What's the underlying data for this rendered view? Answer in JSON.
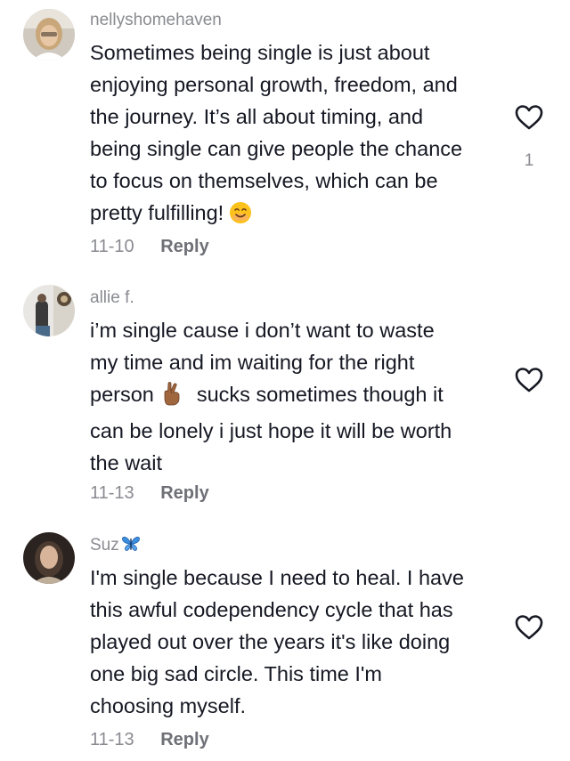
{
  "comments": [
    {
      "username": "nellyshomehaven",
      "lines": [
        "Sometimes being single is just about",
        "enjoying personal growth, freedom, and",
        "the journey. It’s all about timing, and",
        "being single can give people the chance",
        "to focus on themselves, which can be",
        "pretty fulfilling!"
      ],
      "emoji": "smiling-face-emoji",
      "date": "11-10",
      "reply_label": "Reply",
      "like_count": "1",
      "liked": false
    },
    {
      "username": "allie f.",
      "lines": [
        "i’m single cause i don’t want to waste",
        "my time and im waiting for the right",
        "person",
        "sucks sometimes though it",
        "can be lonely i just hope it will be worth",
        "the wait"
      ],
      "emoji": "crossed-fingers-emoji",
      "date": "11-13",
      "reply_label": "Reply",
      "like_count": "",
      "liked": false
    },
    {
      "username": "Suz",
      "username_emoji": "butterfly-emoji",
      "lines": [
        "I'm single because I need to heal. I have",
        "this awful codependency cycle that has",
        "played out over the years it's like doing",
        "one big sad circle. This time I'm",
        "choosing myself."
      ],
      "date": "11-13",
      "reply_label": "Reply",
      "like_count": "",
      "liked": false
    }
  ],
  "colors": {
    "text": "#161823",
    "muted": "#8a8b91",
    "reply": "#6f7077",
    "heart_outline": "#161823"
  },
  "icons": {
    "like": "heart-outline-icon"
  }
}
